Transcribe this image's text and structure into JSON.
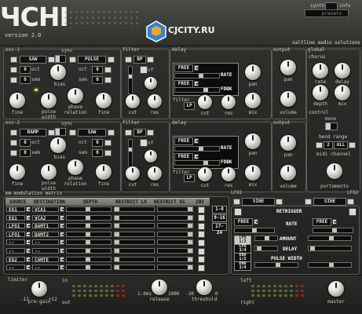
{
  "header": {
    "logo_text": "ЧCHI",
    "version": "version 2.0",
    "brand": "saltline audio solutions",
    "switch_left": "synth",
    "switch_right": "info",
    "preset_label": "presets",
    "watermark": "CJCITY.RU"
  },
  "osc1": {
    "label": "osc-1",
    "sync_label": "sync",
    "wave1": "SAW",
    "wave2": "PULSE",
    "oct_label": "oct",
    "semi_label": "sem",
    "oct1": "0",
    "semi1": "0",
    "oct2": "0",
    "semi2": "0",
    "bias_label": "bias",
    "fine_label": "fine",
    "pulse_width_label": "pulse\nwidth",
    "phase_relation_label": "phase\nrelation"
  },
  "osc2": {
    "label": "osc-2",
    "sync_label": "sync",
    "wave1": "RAMP",
    "wave2": "SAW",
    "oct_label": "oct",
    "semi_label": "sem",
    "oct1": "0",
    "semi1": "0",
    "oct2": "0",
    "semi2": "0",
    "bias_label": "bias",
    "fine_label": "fine",
    "pulse_width_label": "pulse\nwidth",
    "phase_relation_label": "phase\nrelation"
  },
  "filter1": {
    "label": "filter",
    "type": "BP",
    "nf": "nf",
    "cut": "cut",
    "res": "res",
    "filter2": "filter",
    "lp": "LP"
  },
  "filter2": {
    "label": "filter",
    "type": "BP",
    "nf": "nf",
    "cut": "cut",
    "res": "res",
    "filter2": "filter",
    "lp": "LP"
  },
  "delay1": {
    "label": "delay",
    "free1": "FREE",
    "free2": "FREE",
    "rate": "RATE",
    "fdbk": "FDBK",
    "pan": "pan",
    "mix": "mix"
  },
  "delay2": {
    "label": "delay",
    "free1": "FREE",
    "free2": "FREE",
    "rate": "RATE",
    "fdbk": "FDBK",
    "pan": "pan",
    "mix": "mix"
  },
  "output1": {
    "label": "output",
    "pan": "pan",
    "volume": "volume"
  },
  "output2": {
    "label": "output",
    "pan": "pan",
    "volume": "volume"
  },
  "global": {
    "label": "global",
    "chorus": "chorus",
    "rate": "rate",
    "delay": "delay",
    "depth": "depth",
    "mix": "mix",
    "control": "control",
    "mono": "mono",
    "bend_range": "bend range",
    "bend_value": "2",
    "all": "ALL",
    "midi_channel": "midi channel",
    "portamento": "portamento"
  },
  "modmatrix": {
    "title": "mm-modulation matrix",
    "headers": [
      "SOURCE",
      "DESTINATION",
      "DEPTH",
      "RESTRICT LO",
      "RESTRICT HI",
      "INV"
    ],
    "rows": [
      {
        "src": "EG1",
        "dst": "VCA1"
      },
      {
        "src": "EG1",
        "dst": "VCA2"
      },
      {
        "src": "LFO1",
        "dst": "DAMT1"
      },
      {
        "src": "LFO1",
        "dst": "DAMT2"
      },
      {
        "src": "--",
        "dst": "--"
      },
      {
        "src": "--",
        "dst": "--"
      },
      {
        "src": "EG2",
        "dst": "CAMTE"
      },
      {
        "src": "--",
        "dst": "--"
      }
    ],
    "pages": [
      "1-8",
      "9-16",
      "17-24"
    ]
  },
  "lfo": {
    "lfo1": "LFO1",
    "lfo2": "LFO2",
    "wave1": "SINE",
    "wave2": "SINE",
    "retrigger": "RETRIGGER",
    "free1": "FREE",
    "free2": "FREE",
    "rate": "RATE",
    "amount": "AMOUNT",
    "delay": "DELAY",
    "pulse_width": "PULSE WIDTH",
    "sel": [
      "LFO\n1/2",
      "LFO\n3/4",
      "ENV\n1/2",
      "ENV\n3/4"
    ]
  },
  "footer": {
    "limiter": "limiter",
    "pregain_lo": "-12",
    "pregain_label": "pre-gain",
    "pregain_hi": "+12",
    "in": "in",
    "out": "out",
    "release_lo": "1.0ms",
    "release_label": "release",
    "release_hi": "1000",
    "thresh_lo": "-30",
    "thresh_label": "threshold",
    "thresh_hi": "0",
    "left": "left",
    "right": "right",
    "master": "master"
  }
}
